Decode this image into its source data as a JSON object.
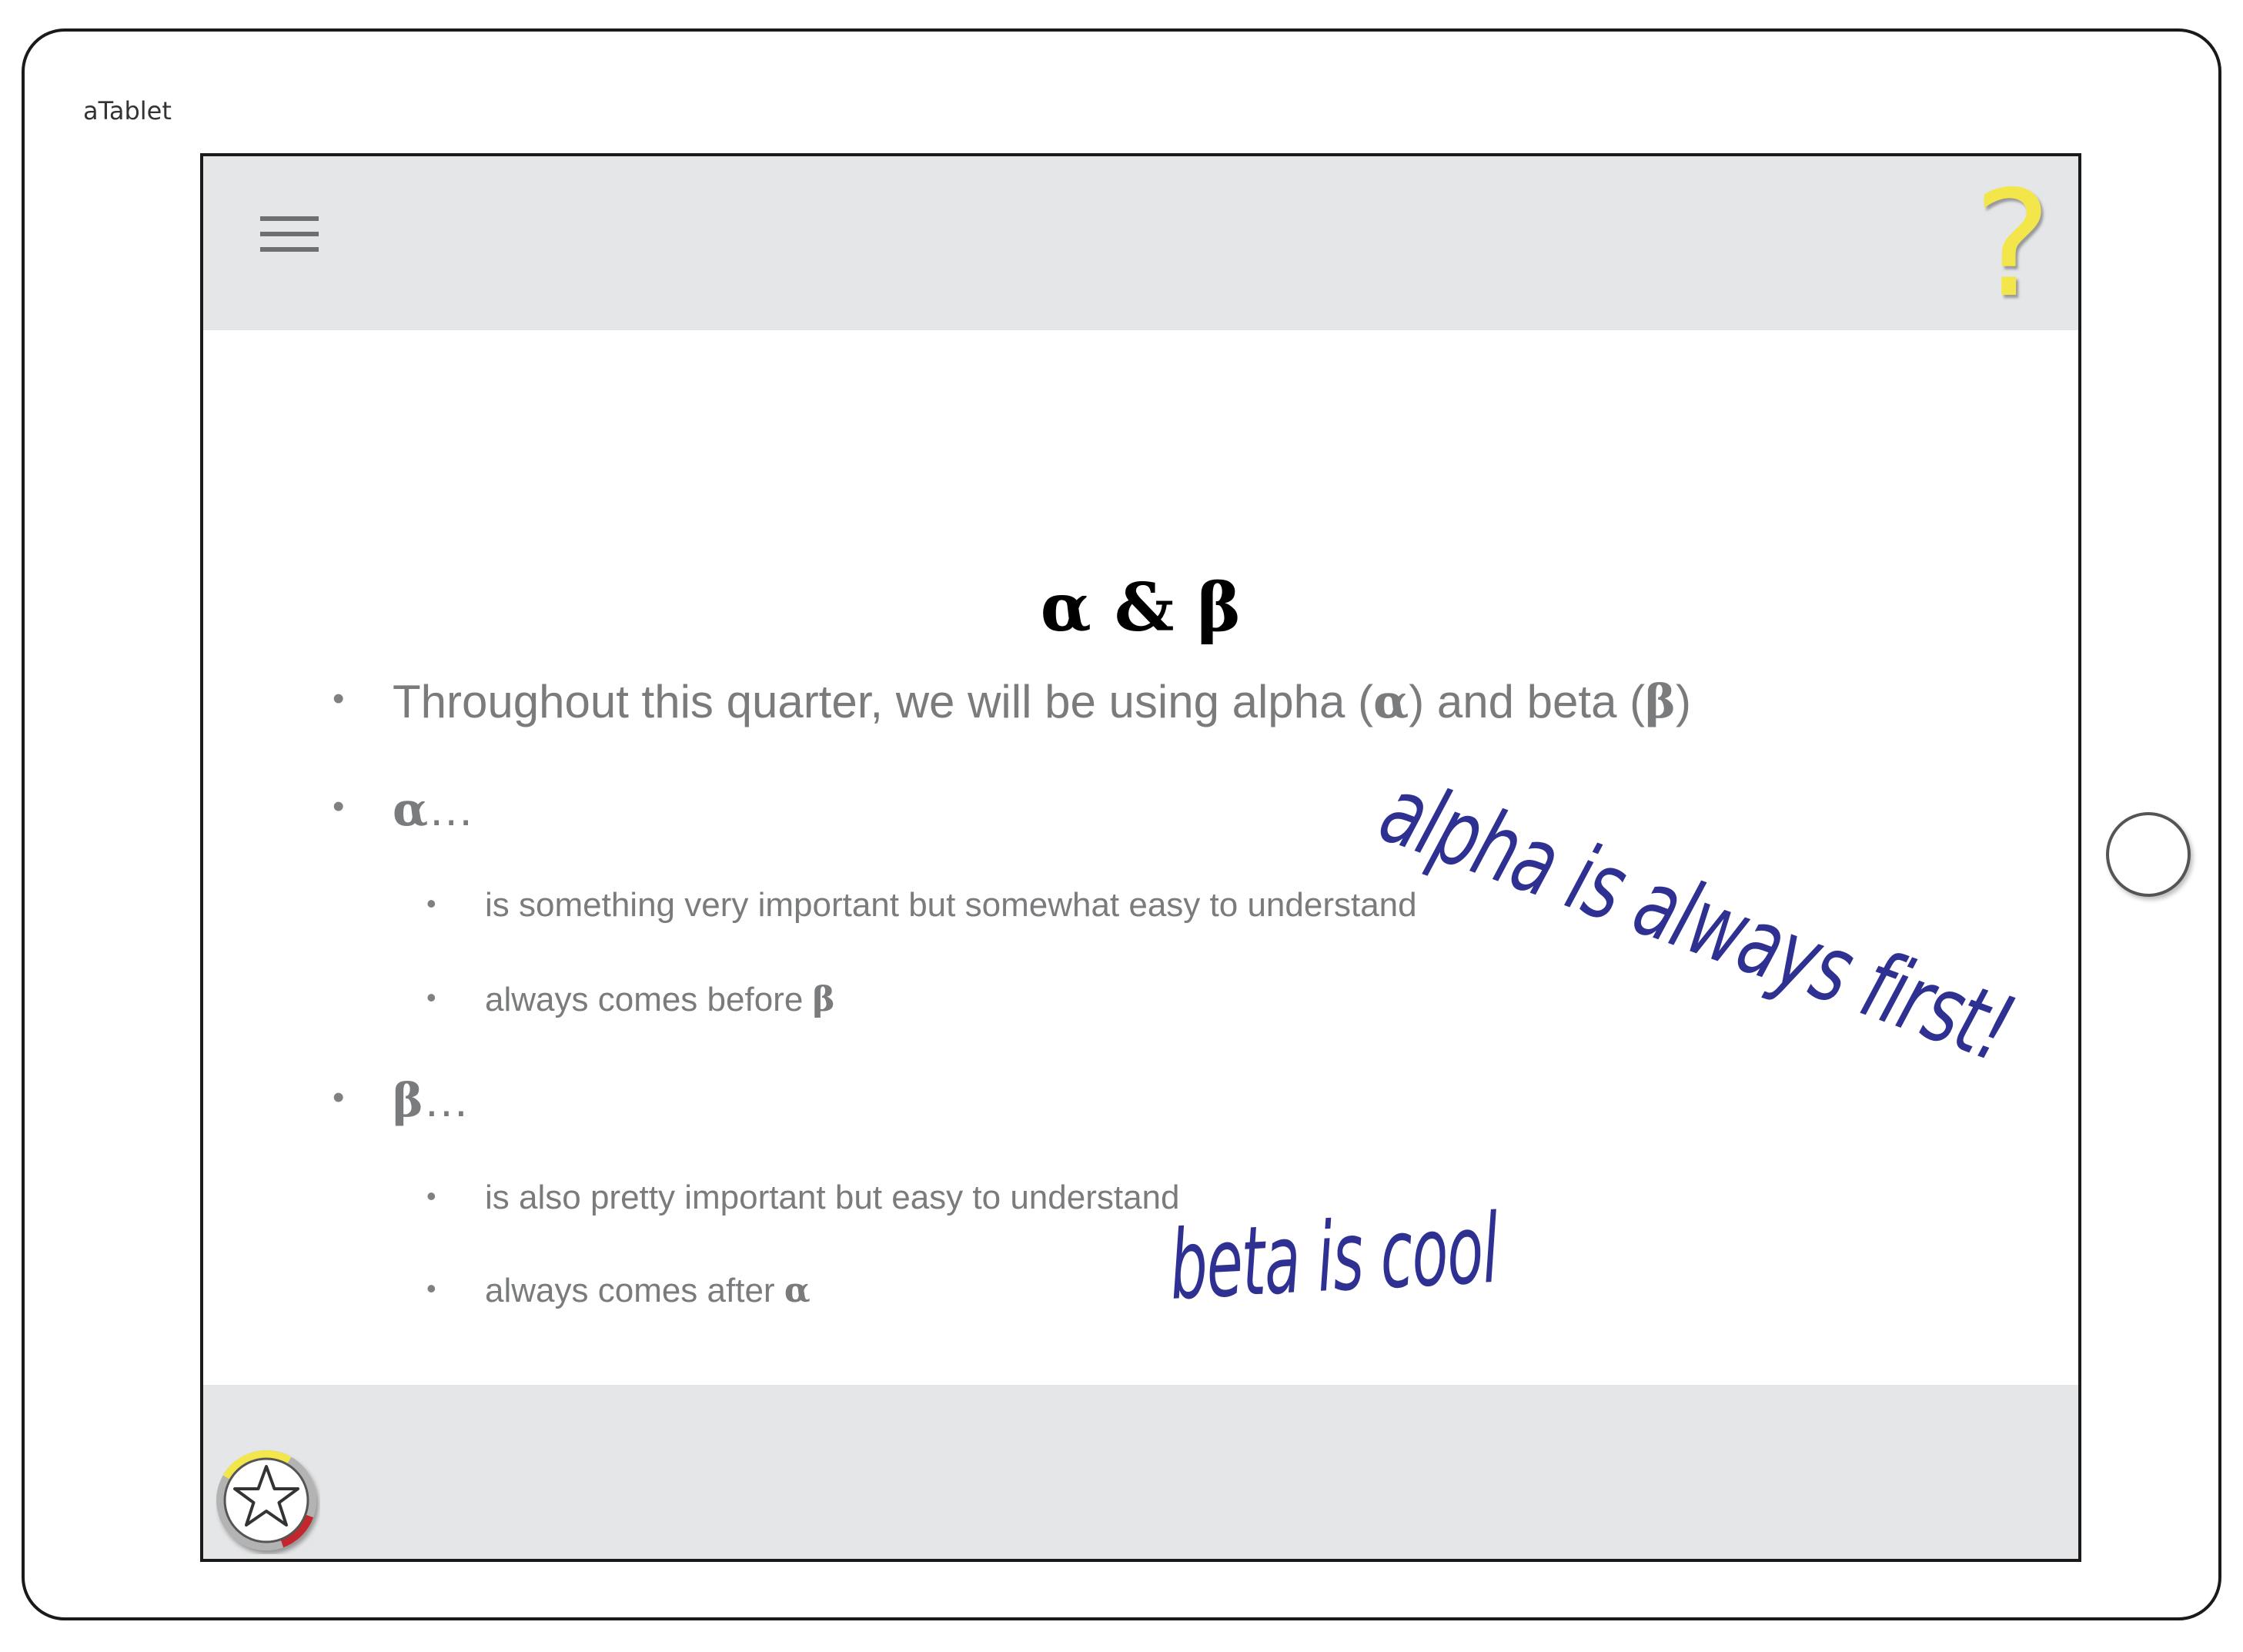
{
  "device": {
    "label": "aTablet"
  },
  "header": {
    "menu_icon": "hamburger-menu-icon",
    "help_glyph": "?",
    "help_color": "#f2e64b"
  },
  "slide": {
    "title": "α & β",
    "bullets": [
      {
        "text_before": "Throughout this quarter, we will be using alpha (",
        "greek1": "α",
        "text_middle": ") and beta (",
        "greek2": "β",
        "text_after": ")"
      },
      {
        "greek": "α",
        "text": "…",
        "sub": [
          {
            "text": "is something very important but somewhat easy to  understand"
          },
          {
            "text": "always comes before ",
            "greek": "β"
          }
        ]
      },
      {
        "greek": "β",
        "text": "…",
        "sub": [
          {
            "text": "is also pretty important but easy to understand"
          },
          {
            "text": "always comes after ",
            "greek": "α"
          }
        ]
      }
    ],
    "bullet_glyph": "•"
  },
  "annotations": {
    "alpha_note": "alpha is always first!",
    "beta_note": "beta is cool",
    "ink_color": "#2e3192"
  },
  "footer": {
    "widget_icon": "star-icon",
    "ring_colors": {
      "top": "#f2e64b",
      "side": "#b3b3b3",
      "bottom": "#c1272d"
    }
  }
}
